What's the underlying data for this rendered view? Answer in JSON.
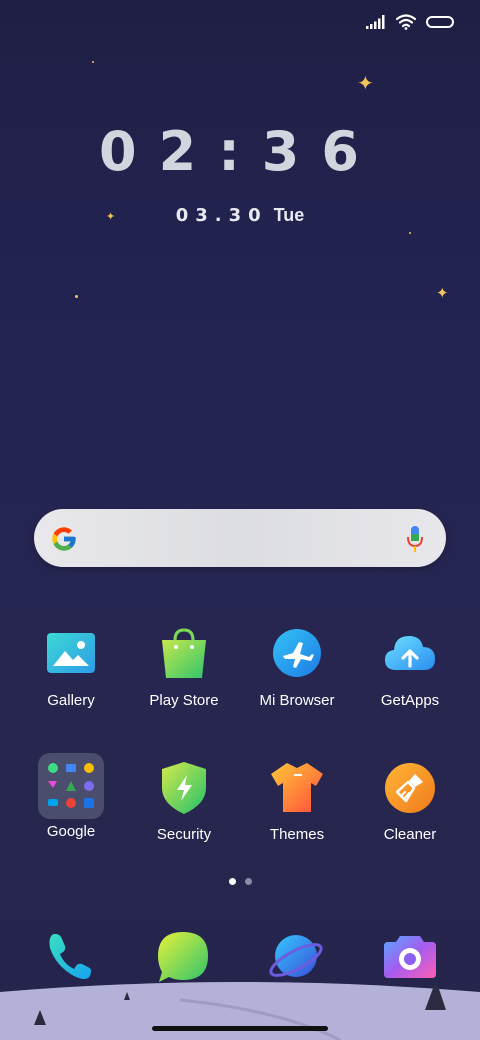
{
  "status": {
    "signal_icon": "signal-bars-icon",
    "wifi_icon": "wifi-icon",
    "battery_icon": "battery-icon"
  },
  "clock": {
    "time": "02:36",
    "date": "03.30",
    "weekday": "Tue"
  },
  "search": {
    "logo_icon": "google-g-icon",
    "mic_icon": "microphone-icon"
  },
  "apps": [
    {
      "label": "Gallery",
      "icon": "gallery-icon"
    },
    {
      "label": "Play Store",
      "icon": "play-store-icon"
    },
    {
      "label": "Mi Browser",
      "icon": "mi-browser-icon"
    },
    {
      "label": "GetApps",
      "icon": "getapps-icon"
    },
    {
      "label": "Google",
      "icon": "google-folder-icon"
    },
    {
      "label": "Security",
      "icon": "security-icon"
    },
    {
      "label": "Themes",
      "icon": "themes-icon"
    },
    {
      "label": "Cleaner",
      "icon": "cleaner-icon"
    }
  ],
  "pager": {
    "pages": 2,
    "current": 1
  },
  "dock": [
    {
      "icon": "phone-icon"
    },
    {
      "icon": "messages-icon"
    },
    {
      "icon": "browser-globe-icon"
    },
    {
      "icon": "camera-icon"
    }
  ],
  "colors": {
    "background": "#242454",
    "star": "#f3c55a",
    "clock_text": "#d3d5de"
  }
}
